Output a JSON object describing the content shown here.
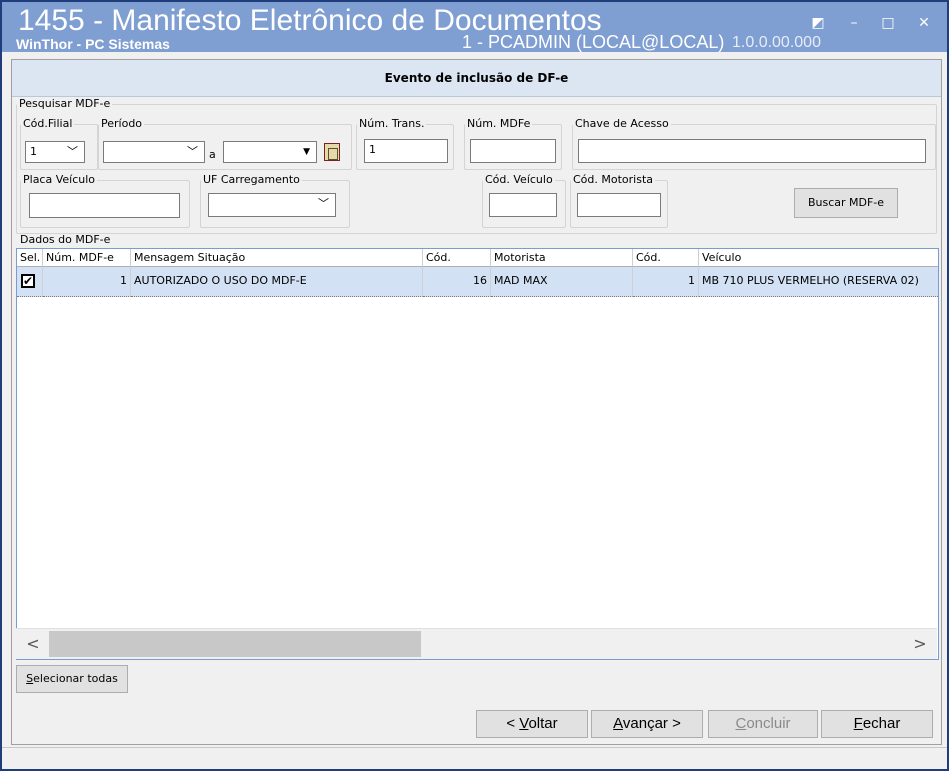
{
  "window": {
    "title": "1455 - Manifesto Eletrônico de Documentos",
    "app_name": "WinThor - PC Sistemas",
    "user_info": "1 - PCADMIN (LOCAL@LOCAL)",
    "version": "1.0.0.00.000",
    "controls": {
      "restore": "◩",
      "minimize": "–",
      "maximize": "□",
      "close": "✕"
    }
  },
  "header": {
    "title": "Evento de inclusão de DF-e"
  },
  "search": {
    "group_label": "Pesquisar MDF-e",
    "filial_label": "Cód.Filial",
    "filial_value": "1",
    "periodo_label": "Período",
    "periodo_start": "",
    "periodo_sep": "a",
    "periodo_end": "",
    "num_trans_label": "Núm. Trans.",
    "num_trans_value": "1",
    "num_mdfe_label": "Núm. MDFe",
    "num_mdfe_value": "",
    "chave_label": "Chave de Acesso",
    "chave_value": "",
    "placa_label": "Placa Veículo",
    "placa_value": "",
    "uf_label": "UF Carregamento",
    "uf_value": "",
    "cod_veiculo_label": "Cód. Veículo",
    "cod_veiculo_value": "",
    "cod_motorista_label": "Cód. Motorista",
    "cod_motorista_value": "",
    "buscar_button": "Buscar MDF-e"
  },
  "dados": {
    "group_label": "Dados do MDF-e",
    "columns": [
      "Sel.",
      "Núm. MDF-e",
      "Mensagem Situação",
      "Cód.",
      "Motorista",
      "Cód.",
      "Veículo"
    ],
    "rows": [
      {
        "sel": "✔",
        "num_mdfe": "1",
        "mensagem": "AUTORIZADO O USO DO MDF-E",
        "cod_motorista": "16",
        "motorista": "MAD MAX",
        "cod_veiculo": "1",
        "veiculo": "MB 710 PLUS VERMELHO (RESERVA 02)"
      }
    ],
    "scroll_left": "<",
    "scroll_right": ">"
  },
  "footer": {
    "select_all_first": "S",
    "select_all_rest": "elecionar todas",
    "voltar_prefix": "< ",
    "voltar_first": "V",
    "voltar_rest": "oltar",
    "avancar_first": "A",
    "avancar_rest": "vançar >",
    "concluir_first": "C",
    "concluir_rest": "oncluir",
    "fechar_first": "F",
    "fechar_rest": "echar"
  }
}
